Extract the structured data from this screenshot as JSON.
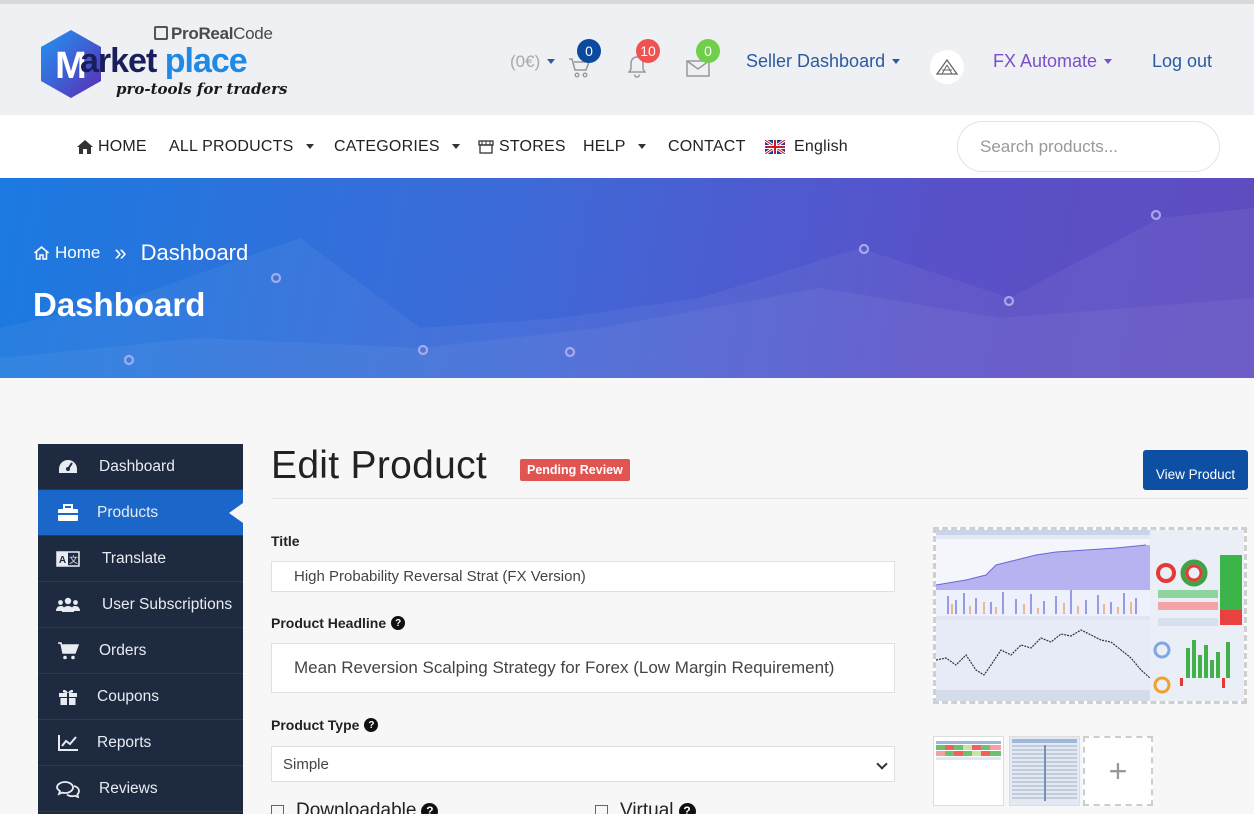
{
  "brand": {
    "top": "ProReal",
    "top_code": "Code",
    "main_a": "arket",
    "main_b": "place",
    "main_m": "M",
    "tagline": "pro-tools for traders"
  },
  "header": {
    "cart_amount": "(0€)",
    "cart_count": "0",
    "notif_count": "10",
    "msg_count": "0",
    "seller_dashboard": "Seller Dashboard",
    "user_name": "FX Automate",
    "logout": "Log out",
    "colors": {
      "cart_badge": "#0b4a9e",
      "notif_badge": "#ef5350",
      "msg_badge": "#6fcf4a"
    }
  },
  "nav": {
    "home": "HOME",
    "all_products": "ALL PRODUCTS",
    "categories": "CATEGORIES",
    "stores": "STORES",
    "help": "HELP",
    "contact": "CONTACT",
    "language": "English",
    "search_placeholder": "Search products..."
  },
  "hero": {
    "crumb_home": "Home",
    "crumb_sep": "»",
    "crumb_current": "Dashboard",
    "title": "Dashboard"
  },
  "sidebar": {
    "items": [
      {
        "label": "Dashboard",
        "icon": "tachometer-icon"
      },
      {
        "label": "Products",
        "icon": "briefcase-icon",
        "active": true
      },
      {
        "label": "Translate",
        "icon": "translate-icon"
      },
      {
        "label": "User Subscriptions",
        "icon": "users-icon"
      },
      {
        "label": "Orders",
        "icon": "cart-icon"
      },
      {
        "label": "Coupons",
        "icon": "gift-icon"
      },
      {
        "label": "Reports",
        "icon": "chart-icon"
      },
      {
        "label": "Reviews",
        "icon": "comments-icon"
      }
    ]
  },
  "main": {
    "title": "Edit Product",
    "status": "Pending Review",
    "view_button": "View Product",
    "title_label": "Title",
    "title_value": "High Probability Reversal Strat (FX Version)",
    "headline_label": "Product Headline",
    "headline_value": "Mean Reversion Scalping Strategy for Forex (Low Margin Requirement)",
    "type_label": "Product Type",
    "type_value": "Simple",
    "downloadable_label": "Downloadable",
    "virtual_label": "Virtual",
    "add_image": "+"
  }
}
